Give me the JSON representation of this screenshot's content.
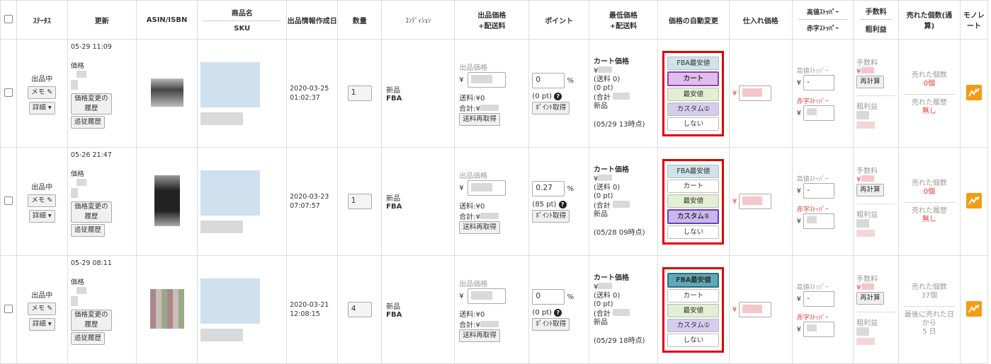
{
  "headers": {
    "status": "ｽﾃｰﾀｽ",
    "updated": "更新",
    "asin": "ASIN/ISBN",
    "product_name": "商品名",
    "sku": "SKU",
    "listing_created": "出品情報作成日",
    "quantity": "数量",
    "condition": "ｺﾝﾃﾞｨｼｮﾝ",
    "listing_price": "出品価格",
    "listing_price_sub": "+配送料",
    "points": "ポイント",
    "min_price": "最低価格",
    "min_price_sub": "+配送料",
    "auto_price": "価格の自動変更",
    "purchase_price": "仕入れ価格",
    "high_stopper": "高値ｽﾄｯﾊﾟｰ",
    "red_stopper": "赤字ｽﾄｯﾊﾟｰ",
    "fee": "手数料",
    "gross_profit": "粗利益",
    "sold_count": "売れた個数(通算)",
    "monorate": "モノレート"
  },
  "common": {
    "status_value": "出品中",
    "memo_label": "メモ",
    "detail_label": "詳細",
    "price_label": "価格",
    "price_history_label": "価格変更の履歴",
    "follow_history_label": "追従履歴",
    "listing_price_label": "出品価格",
    "yen": "¥",
    "shipping": "送料:¥0",
    "total": "合計:¥",
    "reshipping_btn": "送料再取得",
    "percent": "%",
    "point_btn": "ﾎﾟｲﾝﾄ取得",
    "cart_price": "カート価格",
    "shipping_paren": "(送料 0)",
    "points_paren": "(0 pt)",
    "total_paren": "(合計",
    "new_label": "新品",
    "high_stopper_label": "高値ｽﾄｯﾊﾟｰ",
    "red_stopper_label": "赤字ｽﾄｯﾊﾟｰ",
    "fee_label": "手数料",
    "recalc_btn": "再計算",
    "profit_label": "粗利益",
    "auto_options": [
      "FBA最安値",
      "カート",
      "最安値",
      "カスタム①",
      "しない"
    ],
    "colors": {
      "accent_red": "#e00000",
      "brand_orange": "#f39c12"
    }
  },
  "rows": [
    {
      "updated": "05-29 11:09",
      "created_date": "2020-03-25",
      "created_time": "01:02:37",
      "quantity": "1",
      "condition": "新品",
      "fulfillment": "FBA",
      "point_value": "0",
      "point_pt": "(0 pt)",
      "min_time": "(05/29 13時点)",
      "auto_selected": 1,
      "high_value": "-",
      "sold_label_1": "売れた個数",
      "sold_value_1": "0個",
      "sold_label_2": "売れた履歴",
      "sold_value_2": "無し"
    },
    {
      "updated": "05-26 21:47",
      "created_date": "2020-03-23",
      "created_time": "07:07:57",
      "quantity": "1",
      "condition": "新品",
      "fulfillment": "FBA",
      "point_value": "0.27",
      "point_pt": "(85 pt)",
      "min_time": "(05/28 09時点)",
      "auto_selected": 3,
      "high_value": "-",
      "sold_label_1": "売れた個数",
      "sold_value_1": "0個",
      "sold_label_2": "売れた履歴",
      "sold_value_2": "無し"
    },
    {
      "updated": "05-29 08:11",
      "created_date": "2020-03-21",
      "created_time": "12:08:15",
      "quantity": "4",
      "condition": "新品",
      "fulfillment": "FBA",
      "point_value": "0",
      "point_pt": "(0 pt)",
      "min_time": "(05/29 18時点)",
      "auto_selected": 0,
      "high_value": "-",
      "sold_label_1": "売れた個数",
      "sold_value_1": "37個",
      "sold_label_2": "最後に売れた日から",
      "sold_value_2": "5 日"
    }
  ]
}
